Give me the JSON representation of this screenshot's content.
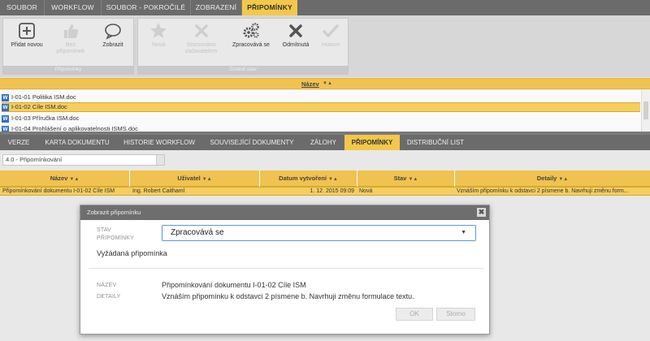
{
  "ribbon_tabs": [
    {
      "label": "SOUBOR"
    },
    {
      "label": "WORKFLOW"
    },
    {
      "label": "SOUBOR - POKROČILÉ"
    },
    {
      "label": "ZOBRAZENÍ"
    },
    {
      "label": "PŘIPOMÍNKY"
    }
  ],
  "ribbon": {
    "groups": [
      {
        "caption": "Připomínky"
      },
      {
        "caption": "Změnit stav"
      }
    ],
    "buttons": [
      {
        "label": "Přidat novou",
        "icon": "plus-square-icon"
      },
      {
        "label": "Bez připomínek",
        "icon": "thumbs-up-icon"
      },
      {
        "label": "Zobrazit",
        "icon": "speech-bubble-icon"
      },
      {
        "label": "Nová",
        "icon": "star-icon"
      },
      {
        "label": "Stornováno zadavatelem",
        "icon": "x-icon"
      },
      {
        "label": "Zpracovává se",
        "icon": "gears-icon"
      },
      {
        "label": "Odmítnutá",
        "icon": "x-icon"
      },
      {
        "label": "Hotovo",
        "icon": "check-icon"
      }
    ]
  },
  "doc_list": {
    "column": "Název",
    "rows": [
      {
        "name": "I-01-01 Politika ISM.doc"
      },
      {
        "name": "I-01-02 Cíle ISM.doc"
      },
      {
        "name": "I-01-03 Příručka ISM.doc"
      },
      {
        "name": "I-01-04 Prohlášení o aplikovatelnosti ISMS.doc"
      }
    ]
  },
  "detail_tabs": [
    {
      "label": "VERZE"
    },
    {
      "label": "KARTA DOKUMENTU"
    },
    {
      "label": "HISTORIE WORKFLOW"
    },
    {
      "label": "SOUVISEJÍCÍ DOKUMENTY"
    },
    {
      "label": "ZÁLOHY"
    },
    {
      "label": "PŘIPOMÍNKY"
    },
    {
      "label": "DISTRIBUČNÍ LIST"
    }
  ],
  "version_select": "4.0 - Připomínkování",
  "comments_grid": {
    "columns": [
      {
        "label": "Název"
      },
      {
        "label": "Uživatel"
      },
      {
        "label": "Datum vytvoření"
      },
      {
        "label": "Stav"
      },
      {
        "label": "Detaily"
      }
    ],
    "row": {
      "nazev": "Připomínkování dokumentu I-01-02 Cíle ISM",
      "uzivatel": "Ing. Robert Caithaml",
      "datum": "1. 12. 2015 09:09",
      "stav": "Nová",
      "detaily": "Vznáším připomínku k odstavci 2 písmene b. Navrhuji změnu form..."
    }
  },
  "sort_arrows": "▼▲",
  "modal": {
    "title": "Zobrazit připomínku",
    "stav_label_1": "STAV",
    "stav_label_2": "PŘIPOMÍNKY",
    "stav_value": "Zpracovává se",
    "requested": "Vyžádaná připomínka",
    "nazev_label": "NÁZEV",
    "nazev_value": "Připomínkování dokumentu I-01-02 Cíle ISM",
    "detaily_label": "DETAILY",
    "detaily_value": "Vznáším připomínku k odstavci 2 písmene b. Navrhuji změnu formulace textu.",
    "ok_label": "OK",
    "storno_label": "Storno",
    "close_glyph": "✖"
  },
  "colors": {
    "accent": "#f3c84a",
    "dark_bar": "#6b6b6b",
    "focus": "#5b9ad5"
  }
}
